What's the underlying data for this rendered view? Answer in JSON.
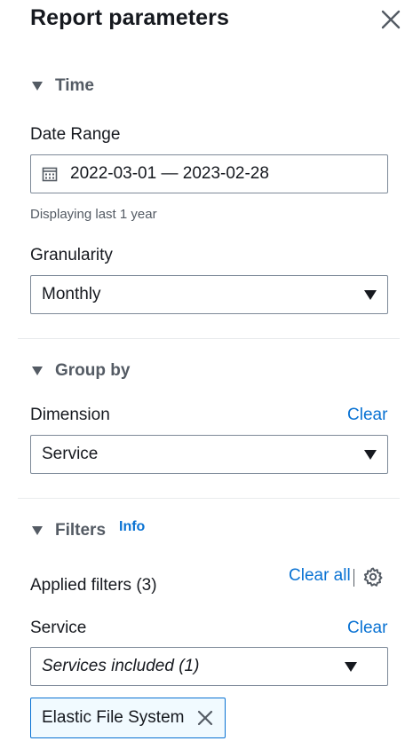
{
  "panel": {
    "title": "Report parameters"
  },
  "time": {
    "heading": "Time",
    "date_range_label": "Date Range",
    "date_range_value": "2022-03-01 — 2023-02-28",
    "date_hint": "Displaying last 1 year",
    "granularity_label": "Granularity",
    "granularity_value": "Monthly"
  },
  "group_by": {
    "heading": "Group by",
    "dimension_label": "Dimension",
    "clear_label": "Clear",
    "dimension_value": "Service"
  },
  "filters": {
    "heading": "Filters",
    "info_label": "Info",
    "applied_label": "Applied filters (3)",
    "clear_all_label": "Clear all",
    "service_label": "Service",
    "service_clear_label": "Clear",
    "service_select_value": "Services included (1)",
    "chips": [
      "Elastic File System"
    ]
  }
}
